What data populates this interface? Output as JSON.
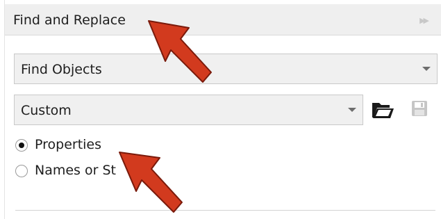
{
  "panel": {
    "title": "Find and Replace",
    "collapse_icon": "double-chevron-right-icon"
  },
  "find_type": {
    "selected": "Find Objects"
  },
  "preset": {
    "selected": "Custom",
    "open_icon": "folder-icon",
    "save_icon": "save-icon"
  },
  "search_mode": {
    "options": [
      {
        "label": "Properties",
        "checked": true
      },
      {
        "label": "Names or St",
        "checked": false
      }
    ]
  },
  "colors": {
    "header_bg": "#efefef",
    "annotation_arrow": "#d23a1e"
  }
}
